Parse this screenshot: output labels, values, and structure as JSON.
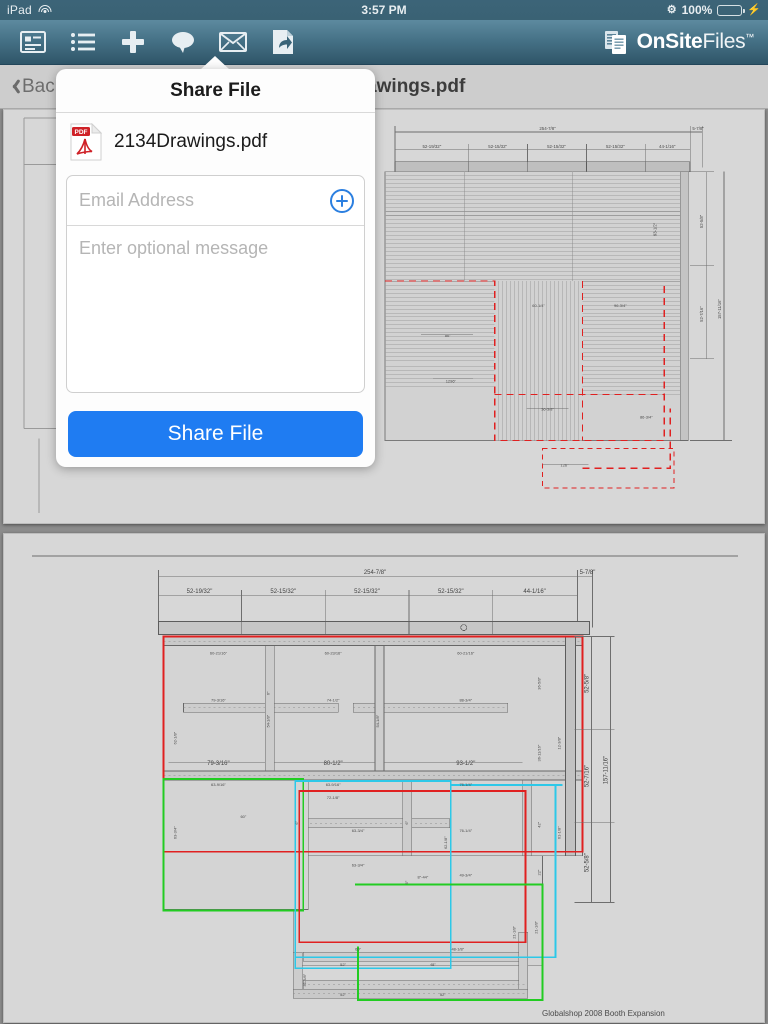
{
  "status_bar": {
    "device": "iPad",
    "wifi_icon": "wifi-icon",
    "time": "3:57 PM",
    "bluetooth_icon": "bluetooth-icon",
    "battery_percent": "100%",
    "battery_icon": "battery-icon",
    "charging_icon": "lightning-bolt-icon",
    "battery_color": "#4cd755"
  },
  "toolbar": {
    "items": [
      {
        "name": "details-view-icon",
        "label": "Details View"
      },
      {
        "name": "list-view-icon",
        "label": "List View"
      },
      {
        "name": "add-icon",
        "label": "Add"
      },
      {
        "name": "comment-icon",
        "label": "Comment"
      },
      {
        "name": "mail-icon",
        "label": "Email"
      },
      {
        "name": "share-document-icon",
        "label": "Share"
      }
    ],
    "logo_bold": "OnSite",
    "logo_light": "Files",
    "logo_tm": "™",
    "background_top": "#5d8a9f",
    "background_bottom": "#2f5568"
  },
  "navbar": {
    "back_label": "Back",
    "back_icon": "chevron-left-icon",
    "title": "2134Drawings.pdf"
  },
  "popover": {
    "title": "Share File",
    "file_icon": "pdf-file-icon",
    "file_icon_label": "PDF",
    "file_name": "2134Drawings.pdf",
    "email_value": "",
    "email_placeholder": "Email Address",
    "add_recipient_icon": "plus-circle-icon",
    "message_value": "",
    "message_placeholder": "Enter optional message",
    "share_button_label": "Share File",
    "share_button_color": "#1f7cf2",
    "accent_color": "#2b7fe0"
  },
  "document": {
    "page_background": "#d7d7d7",
    "caption": "Globalshop 2008 Booth Expansion",
    "top_dimensions": [
      "52-19/32\"",
      "52-15/32\"",
      "52-15/32\"",
      "52-15/32\"",
      "44-1/16\""
    ],
    "overall_width": "254-7/8\"",
    "edge_dimension": "5-7/8\"",
    "right_dimensions": [
      "52-5/8\"",
      "52-7/16\"",
      "52-5/8\""
    ],
    "overall_height": "157-11/16\"",
    "room_dimensions": [
      "79-3/16\"",
      "80-1/2\"",
      "93-1/2\""
    ],
    "overlay_colors": {
      "red": "#e02020",
      "green": "#22cc22",
      "cyan": "#2cc8e8"
    }
  }
}
